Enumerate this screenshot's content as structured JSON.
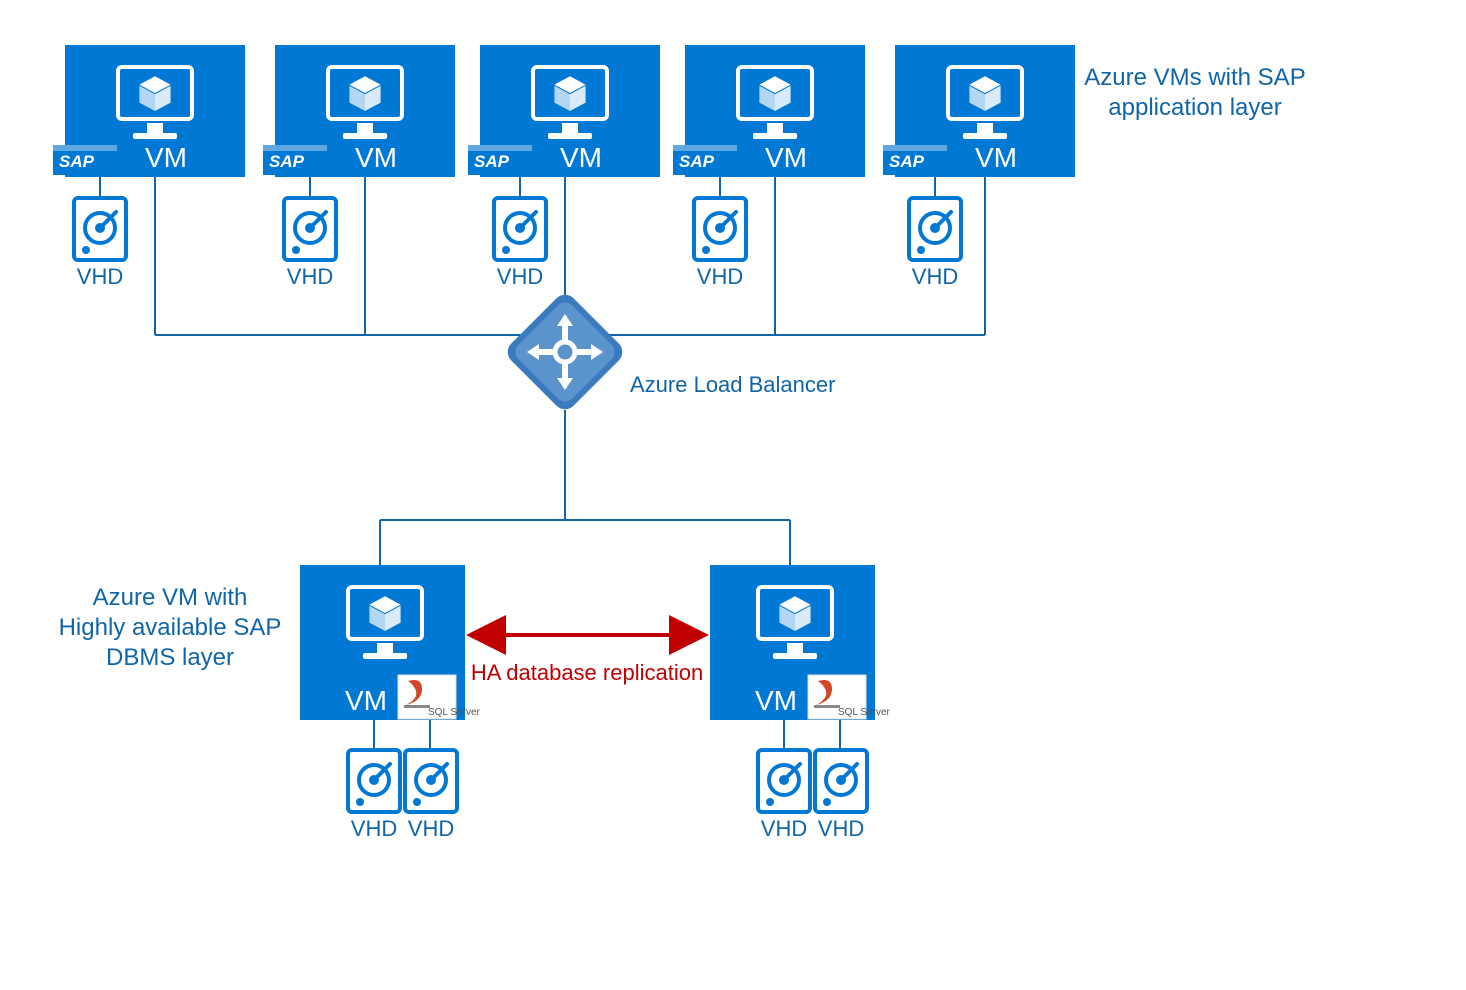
{
  "labels": {
    "app_layer_1": "Azure VMs with SAP",
    "app_layer_2": "application layer",
    "dbms_1": "Azure VM with",
    "dbms_2": "Highly available SAP",
    "dbms_3": "DBMS layer",
    "loadbalancer": "Azure Load Balancer",
    "replication": "HA database replication",
    "vhd": "VHD",
    "vm": "VM",
    "sap": "SAP",
    "sqlserver": "SQL Server"
  },
  "colors": {
    "azure_blue": "#0078d4",
    "label_blue": "#1065a8",
    "replication_red": "#c00000",
    "connector": "#1065a8"
  },
  "diagram": {
    "app_vm_count": 5,
    "db_vm_count": 2
  }
}
